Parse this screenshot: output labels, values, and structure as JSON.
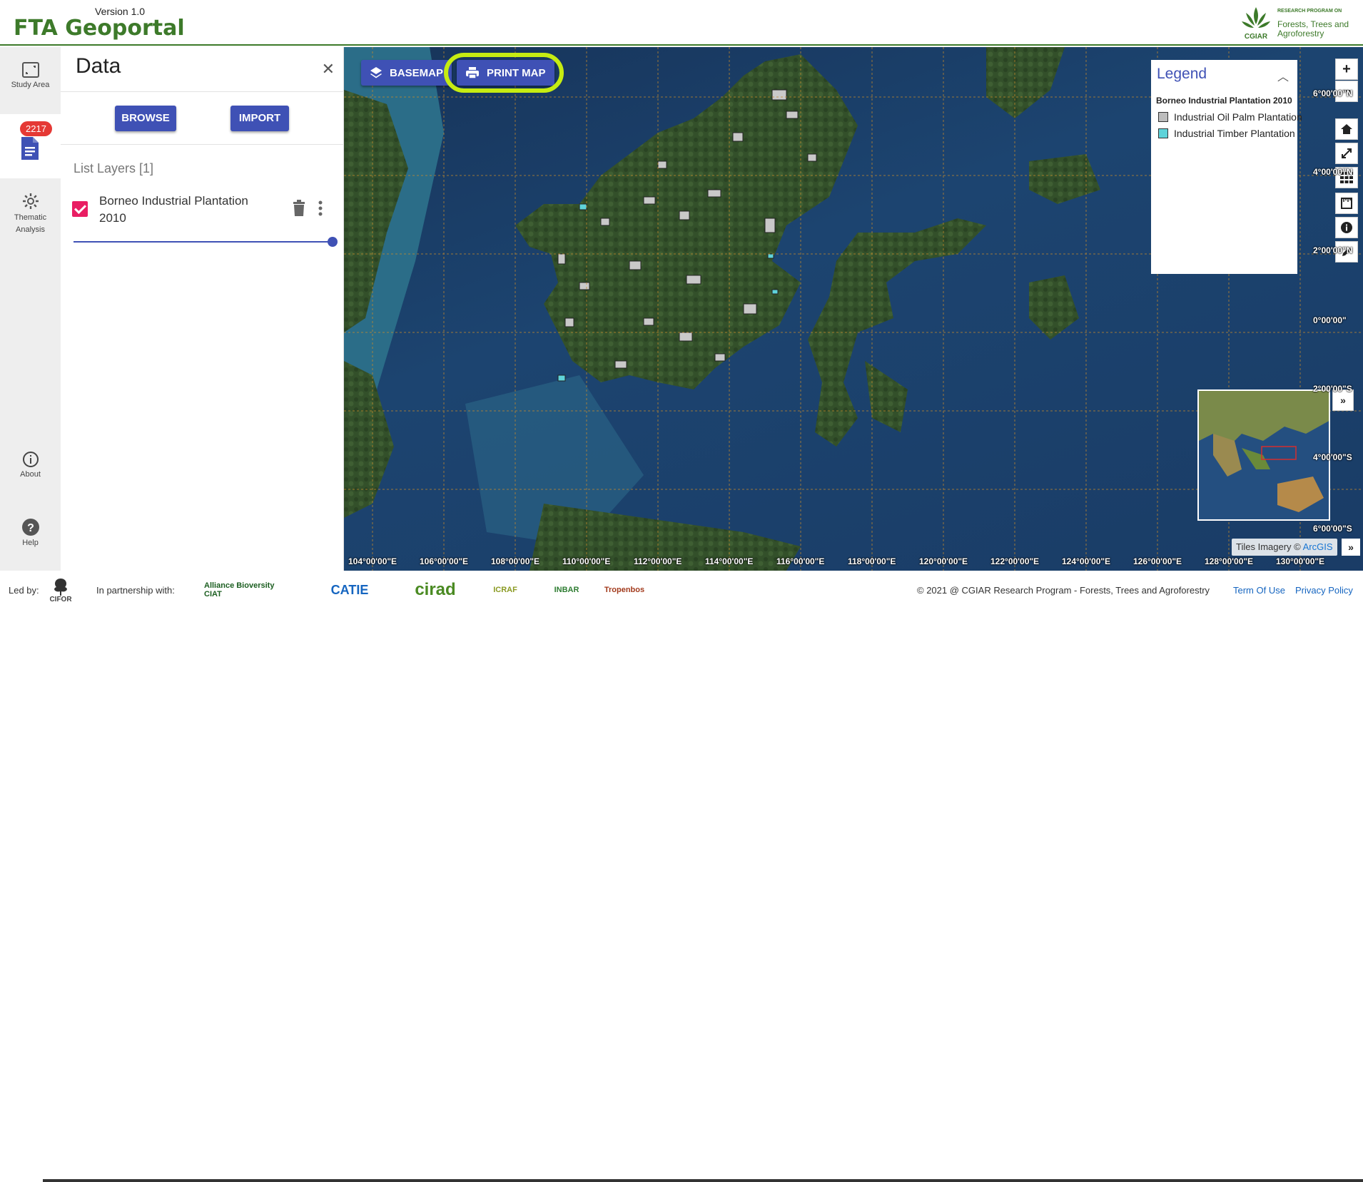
{
  "header": {
    "version": "Version 1.0",
    "title": "FTA Geoportal",
    "cgiar_line1": "RESEARCH PROGRAM ON",
    "cgiar_line2": "Forests, Trees and Agroforestry",
    "cgiar_name": "CGIAR"
  },
  "rail": {
    "study_area": "Study Area",
    "data_badge": "2217",
    "thematic": "Thematic Analysis",
    "about": "About",
    "help": "Help"
  },
  "panel": {
    "title": "Data",
    "browse": "BROWSE",
    "import": "IMPORT",
    "list_layers": "List Layers [1]",
    "layer_name": "Borneo Industrial Plantation 2010",
    "layer_checked": true,
    "opacity": 1.0
  },
  "map": {
    "basemap_label": "BASEMAP",
    "print_label": "PRINT MAP",
    "legend": {
      "title": "Legend",
      "layer": "Borneo Industrial Plantation 2010",
      "items": [
        {
          "label": "Industrial Oil Palm Plantation",
          "color": "#bdbdbd"
        },
        {
          "label": "Industrial Timber Plantation",
          "color": "#5fd3d9"
        }
      ]
    },
    "zoom_in": "+",
    "zoom_out": "−",
    "minimap_toggle": "»",
    "attribution_prefix": "Tiles Imagery ©",
    "attribution_link": "ArcGIS",
    "attribution_toggle": "»",
    "lon_labels": [
      "104°00'00\"E",
      "106°00'00\"E",
      "108°00'00\"E",
      "110°00'00\"E",
      "112°00'00\"E",
      "114°00'00\"E",
      "116°00'00\"E",
      "118°00'00\"E",
      "120°00'00\"E",
      "122°00'00\"E",
      "124°00'00\"E",
      "126°00'00\"E",
      "128°00'00\"E",
      "130°00'00\"E"
    ],
    "lat_labels": [
      "6°00'00\"N",
      "4°00'00\"N",
      "2°00'00\"N",
      "0°00'00\"",
      "2°00'00\"S",
      "4°00'00\"S",
      "6°00'00\"S"
    ]
  },
  "footer": {
    "led_by": "Led by:",
    "cifor": "CIFOR",
    "partnership": "In partnership with:",
    "partners": [
      "Alliance Bioversity CIAT",
      "CATIE",
      "cirad",
      "ICRAF",
      "INBAR",
      "Tropenbos"
    ],
    "copyright": "© 2021 @ CGIAR Research Program - Forests, Trees and Agroforestry",
    "terms": "Term Of Use",
    "privacy": "Privacy Policy"
  }
}
